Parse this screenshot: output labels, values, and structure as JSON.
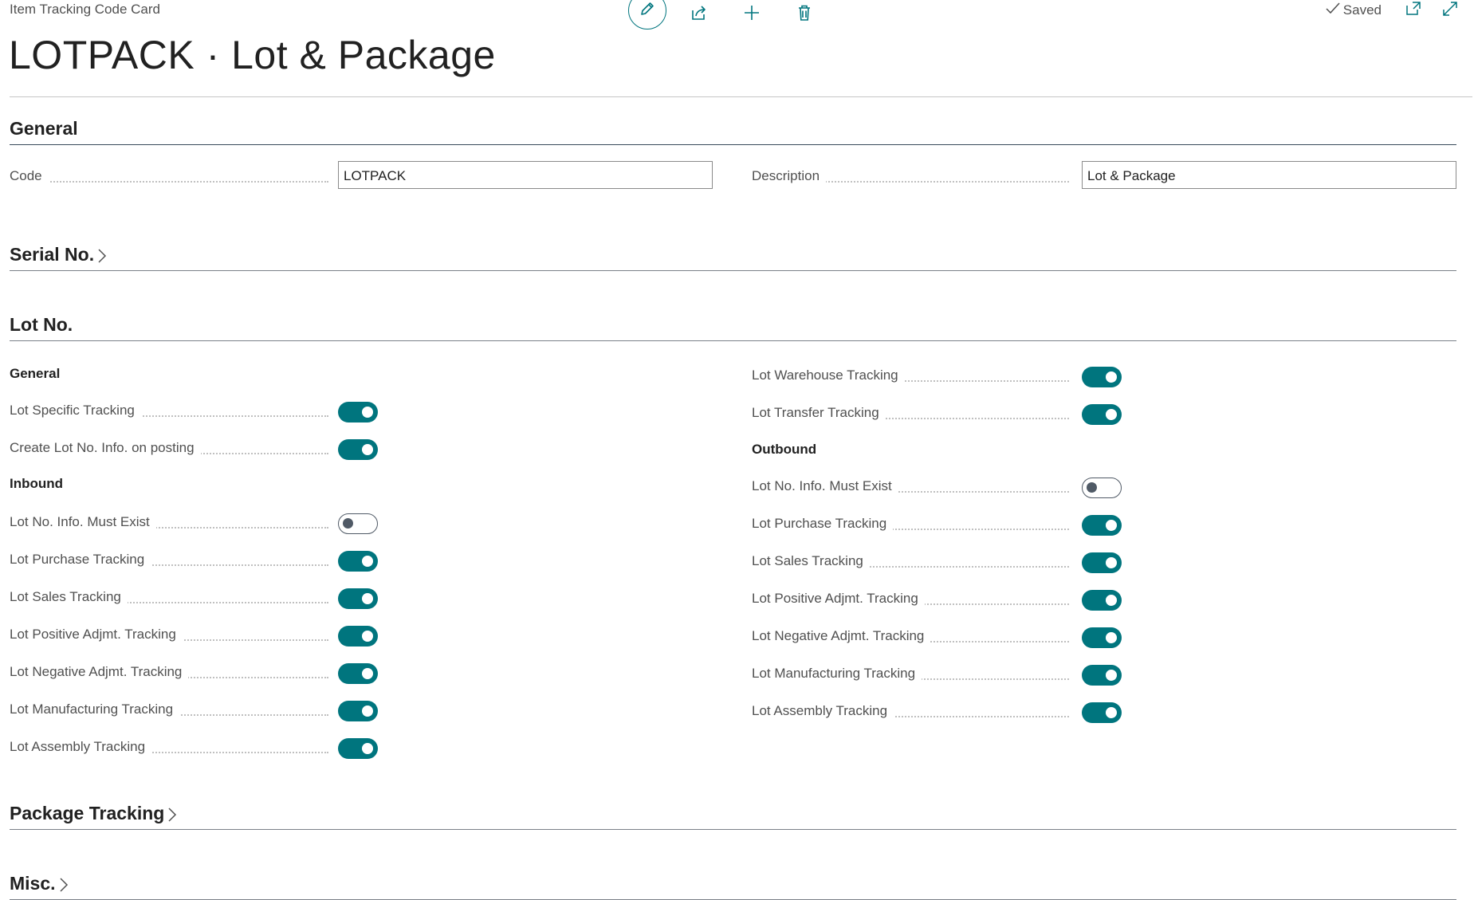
{
  "header": {
    "caption": "Item Tracking Code Card",
    "title": "LOTPACK · Lot & Package",
    "status": "Saved"
  },
  "actions": [
    "edit-icon",
    "share-icon",
    "plus-icon",
    "trash-icon"
  ],
  "general": {
    "heading": "General",
    "code_label": "Code",
    "code_value": "LOTPACK",
    "description_label": "Description",
    "description_value": "Lot & Package"
  },
  "serial": {
    "heading": "Serial No."
  },
  "lot": {
    "heading": "Lot No.",
    "left": {
      "general_heading": "General",
      "general_items": [
        {
          "label": "Lot Specific Tracking",
          "on": true
        },
        {
          "label": "Create Lot No. Info. on posting",
          "on": true
        }
      ],
      "inbound_heading": "Inbound",
      "inbound_items": [
        {
          "label": "Lot No. Info. Must Exist",
          "on": false
        },
        {
          "label": "Lot Purchase Tracking",
          "on": true
        },
        {
          "label": "Lot Sales Tracking",
          "on": true
        },
        {
          "label": "Lot Positive Adjmt. Tracking",
          "on": true
        },
        {
          "label": "Lot Negative Adjmt. Tracking",
          "on": true
        },
        {
          "label": "Lot Manufacturing Tracking",
          "on": true
        },
        {
          "label": "Lot Assembly Tracking",
          "on": true
        }
      ]
    },
    "right": {
      "top_items": [
        {
          "label": "Lot Warehouse Tracking",
          "on": true
        },
        {
          "label": "Lot Transfer Tracking",
          "on": true
        }
      ],
      "outbound_heading": "Outbound",
      "outbound_items": [
        {
          "label": "Lot No. Info. Must Exist",
          "on": false
        },
        {
          "label": "Lot Purchase Tracking",
          "on": true
        },
        {
          "label": "Lot Sales Tracking",
          "on": true
        },
        {
          "label": "Lot Positive Adjmt. Tracking",
          "on": true
        },
        {
          "label": "Lot Negative Adjmt. Tracking",
          "on": true
        },
        {
          "label": "Lot Manufacturing Tracking",
          "on": true
        },
        {
          "label": "Lot Assembly Tracking",
          "on": true
        }
      ]
    }
  },
  "package": {
    "heading": "Package Tracking"
  },
  "misc": {
    "heading": "Misc."
  },
  "colors": {
    "accent": "#00757e",
    "text": "#212121",
    "label": "#505050"
  }
}
